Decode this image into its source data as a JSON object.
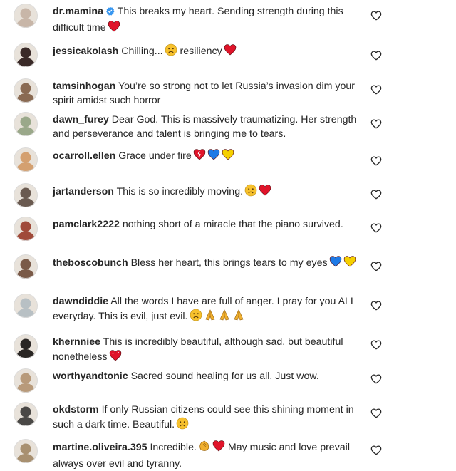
{
  "comments": [
    {
      "username": "dr.mamina",
      "verified": true,
      "text": "This breaks my heart. Sending strength during this difficult time",
      "emojis": [
        "red-heart"
      ],
      "avatar_color": "#c8b6a8"
    },
    {
      "username": "jessicakolash",
      "verified": false,
      "text": "Chilling...",
      "emojis": [
        "sad-face"
      ],
      "text_after": "resiliency",
      "emojis_after": [
        "red-heart"
      ],
      "avatar_color": "#3a2a28"
    },
    {
      "username": "tamsinhogan",
      "verified": false,
      "text": "You’re so strong not to let Russia’s invasion dim your spirit amidst such horror",
      "emojis": [],
      "avatar_color": "#8a6a52"
    },
    {
      "username": "dawn_furey",
      "verified": false,
      "text": "Dear God. This is massively traumatizing. Her strength and perseverance and talent is bringing me to tears.",
      "emojis": [],
      "avatar_color": "#9aa88a"
    },
    {
      "username": "ocarroll.ellen",
      "verified": false,
      "text": "Grace under fire",
      "emojis": [
        "broken-heart",
        "blue-heart",
        "yellow-heart"
      ],
      "avatar_color": "#d4a070"
    },
    {
      "username": "jartanderson",
      "verified": false,
      "text": "This is so incredibly moving.",
      "emojis": [
        "sad-face",
        "red-heart"
      ],
      "avatar_color": "#6a5a50"
    },
    {
      "username": "pamclark2222",
      "verified": false,
      "text": "nothing short of a miracle that the piano survived.",
      "emojis": [],
      "avatar_color": "#a04a3a"
    },
    {
      "username": "theboscobunch",
      "verified": false,
      "text": "Bless her heart, this brings tears to my eyes",
      "emojis": [
        "blue-heart",
        "yellow-heart"
      ],
      "avatar_color": "#7a5a48"
    },
    {
      "username": "dawndiddie",
      "verified": false,
      "text": "All the words I have are full of anger. I pray for you ALL everyday. This is evil, just evil.",
      "emojis": [
        "sad-face",
        "folded-hands",
        "folded-hands",
        "folded-hands"
      ],
      "avatar_color": "#b8c0c4"
    },
    {
      "username": "khernniee",
      "verified": false,
      "text": "This is incredibly beautiful, although sad, but beautiful nonetheless",
      "emojis": [
        "sparkling-heart"
      ],
      "avatar_color": "#2a2624"
    },
    {
      "username": "worthyandtonic",
      "verified": false,
      "text": "Sacred sound healing for us all. Just wow.",
      "emojis": [],
      "avatar_color": "#b89a7a"
    },
    {
      "username": "okdstorm",
      "verified": false,
      "text": "If only Russian citizens could see this shining moment in such a dark time. Beautiful.",
      "emojis": [
        "sad-face"
      ],
      "avatar_color": "#4a4846"
    },
    {
      "username": "martine.oliveira.395",
      "verified": false,
      "text": "Incredible.",
      "emojis": [
        "clapping-hands",
        "red-heart"
      ],
      "text_after": "May music and love prevail always over evil and tyranny.",
      "emojis_after": [],
      "avatar_color": "#a89070"
    }
  ],
  "colors": {
    "text": "#262626",
    "verified": "#3897f0",
    "red_heart": "#e0142a",
    "blue_heart": "#1e7ae6",
    "yellow_heart": "#f5d000",
    "emoji_face": "#f7c12d"
  }
}
